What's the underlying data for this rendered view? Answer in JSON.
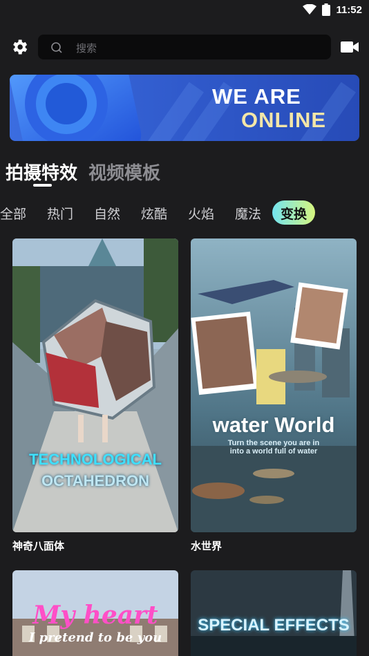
{
  "status": {
    "time": "11:52",
    "icons": [
      "wifi-icon",
      "battery-icon"
    ]
  },
  "header": {
    "settings_icon": "gear-icon",
    "search_placeholder": "搜索",
    "camera_icon": "video-camera-icon"
  },
  "banner": {
    "line1": "WE ARE",
    "line2": "ONLINE"
  },
  "main_tabs": [
    {
      "label": "拍摄特效",
      "active": true
    },
    {
      "label": "视频模板",
      "active": false
    }
  ],
  "categories": [
    {
      "label": "全部"
    },
    {
      "label": "热门"
    },
    {
      "label": "自然"
    },
    {
      "label": "炫酷"
    },
    {
      "label": "火焰"
    },
    {
      "label": "魔法"
    },
    {
      "label": "变换",
      "active": true
    }
  ],
  "cards": [
    {
      "title": "神奇八面体",
      "overlay": [
        "TECHNOLOGICAL",
        "OCTAHEDRON"
      ]
    },
    {
      "title": "水世界",
      "overlay": [
        "water World",
        "Turn the scene you are in",
        "into a world full of water"
      ]
    },
    {
      "title": "",
      "overlay": [
        "My heart",
        "I pretend to be you"
      ]
    },
    {
      "title": "",
      "overlay": [
        "SPECIAL EFFECTS"
      ]
    }
  ],
  "colors": {
    "background": "#1c1c1e",
    "accent_gradient": [
      "#73e4f0",
      "#d6f57e"
    ],
    "banner_blue": "#2f58c9"
  }
}
